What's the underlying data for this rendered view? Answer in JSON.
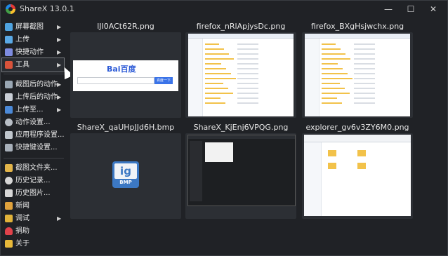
{
  "window": {
    "title": "ShareX 13.0.1",
    "buttons": {
      "minimize": "—",
      "maximize": "☐",
      "close": "✕"
    }
  },
  "sidebar": {
    "items": [
      {
        "label": "屏幕截图",
        "icon": "capture-icon",
        "color": "#4fa3e0",
        "arrow": "▶"
      },
      {
        "label": "上传",
        "icon": "upload-arrow-icon",
        "color": "#5aa9e6",
        "arrow": "▶"
      },
      {
        "label": "快捷动作",
        "icon": "grid-icon",
        "color": "#7e8ce0",
        "arrow": "▶"
      },
      {
        "label": "工具",
        "icon": "toolbox-icon",
        "color": "#d9533b",
        "arrow": "▶"
      },
      {
        "label": "截图后的动作",
        "icon": "after-capture-icon",
        "color": "#9aa7b4",
        "arrow": "▶"
      },
      {
        "label": "上传后的动作",
        "icon": "cloud-icon",
        "color": "#c9ced6",
        "arrow": "▶"
      },
      {
        "label": "上传至...",
        "icon": "upload-to-icon",
        "color": "#4b89d8",
        "arrow": "▶"
      },
      {
        "label": "动作设置...",
        "icon": "gear-icon",
        "color": "#b8bec6",
        "arrow": ""
      },
      {
        "label": "应用程序设置...",
        "icon": "wrench-icon",
        "color": "#c0c6cd",
        "arrow": ""
      },
      {
        "label": "快捷键设置...",
        "icon": "keyboard-icon",
        "color": "#a8b0ba",
        "arrow": ""
      },
      {
        "label": "截图文件夹...",
        "icon": "folder-icon",
        "color": "#e3b54a",
        "arrow": ""
      },
      {
        "label": "历史记录...",
        "icon": "history-icon",
        "color": "#d7d7d7",
        "arrow": ""
      },
      {
        "label": "历史图片...",
        "icon": "image-history-icon",
        "color": "#d7d7d7",
        "arrow": ""
      },
      {
        "label": "新闻",
        "icon": "megaphone-icon",
        "color": "#e0a23c",
        "arrow": ""
      },
      {
        "label": "调试",
        "icon": "bug-icon",
        "color": "#e0b23a",
        "arrow": "▶"
      },
      {
        "label": "捐助",
        "icon": "heart-icon",
        "color": "#e0424b",
        "arrow": ""
      },
      {
        "label": "关于",
        "icon": "crown-icon",
        "color": "#e8b93a",
        "arrow": ""
      }
    ]
  },
  "thumbnails": [
    {
      "name": "lJI0ACt62R.png",
      "kind": "baidu",
      "baidu_logo": "Bai百度",
      "baidu_btn": "百度一下"
    },
    {
      "name": "firefox_nRlApjysDc.png",
      "kind": "explorer-white"
    },
    {
      "name": "firefox_BXgHsjwchx.png",
      "kind": "explorer-white"
    },
    {
      "name": "ShareX_qaUHpJJd6H.bmp",
      "kind": "bmp-icon",
      "icon_letters": "ig",
      "icon_caption": "BMP"
    },
    {
      "name": "ShareX_KjEnj6VPQG.png",
      "kind": "dark-window"
    },
    {
      "name": "explorer_gv6v3ZY6M0.png",
      "kind": "explorer-window"
    }
  ]
}
